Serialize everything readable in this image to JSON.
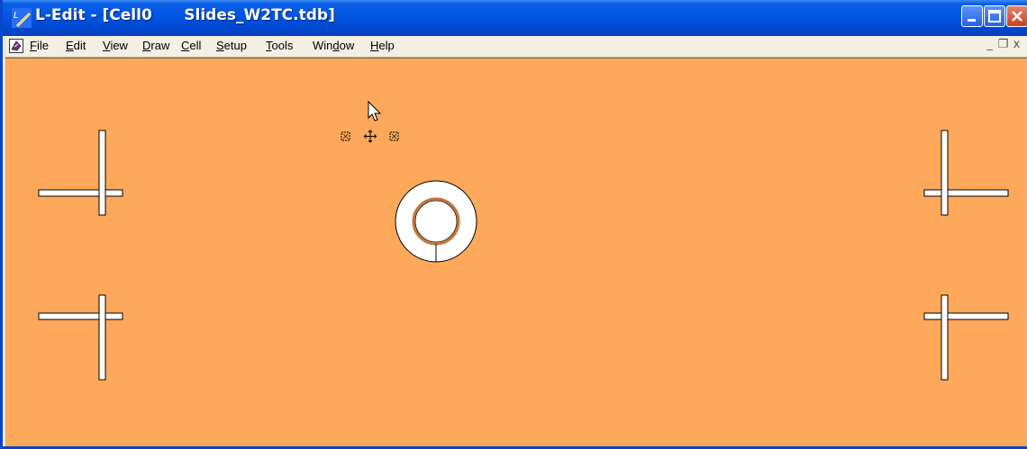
{
  "window": {
    "title": "L-Edit - [Cell0      Slides_W2TC.tdb]",
    "icon": "l-edit-app-icon"
  },
  "menu": {
    "items": [
      {
        "label": "File",
        "accel": "F",
        "rest": "ile"
      },
      {
        "label": "Edit",
        "accel": "E",
        "rest": "dit"
      },
      {
        "label": "View",
        "accel": "V",
        "rest": "iew"
      },
      {
        "label": "Draw",
        "accel": "D",
        "rest": "raw"
      },
      {
        "label": "Cell",
        "accel": "C",
        "rest": "ell"
      },
      {
        "label": "Setup",
        "accel": "S",
        "rest": "etup"
      },
      {
        "label": "Tools",
        "accel": "T",
        "rest": "ools"
      },
      {
        "label": "Window",
        "accel_pre": "Win",
        "accel": "d",
        "rest": "ow"
      },
      {
        "label": "Help",
        "accel": "H",
        "rest": "elp"
      }
    ],
    "mdi_minimize": "_",
    "mdi_restore": "❐",
    "mdi_close": "x"
  },
  "canvas": {
    "background": "#fda85a",
    "shape_fill": "#ffffff",
    "shape_stroke": "#000000",
    "ring_inner_stroke": "#c87533"
  },
  "colors": {
    "titlebar": "#0055e3",
    "close_button": "#c9421c"
  }
}
